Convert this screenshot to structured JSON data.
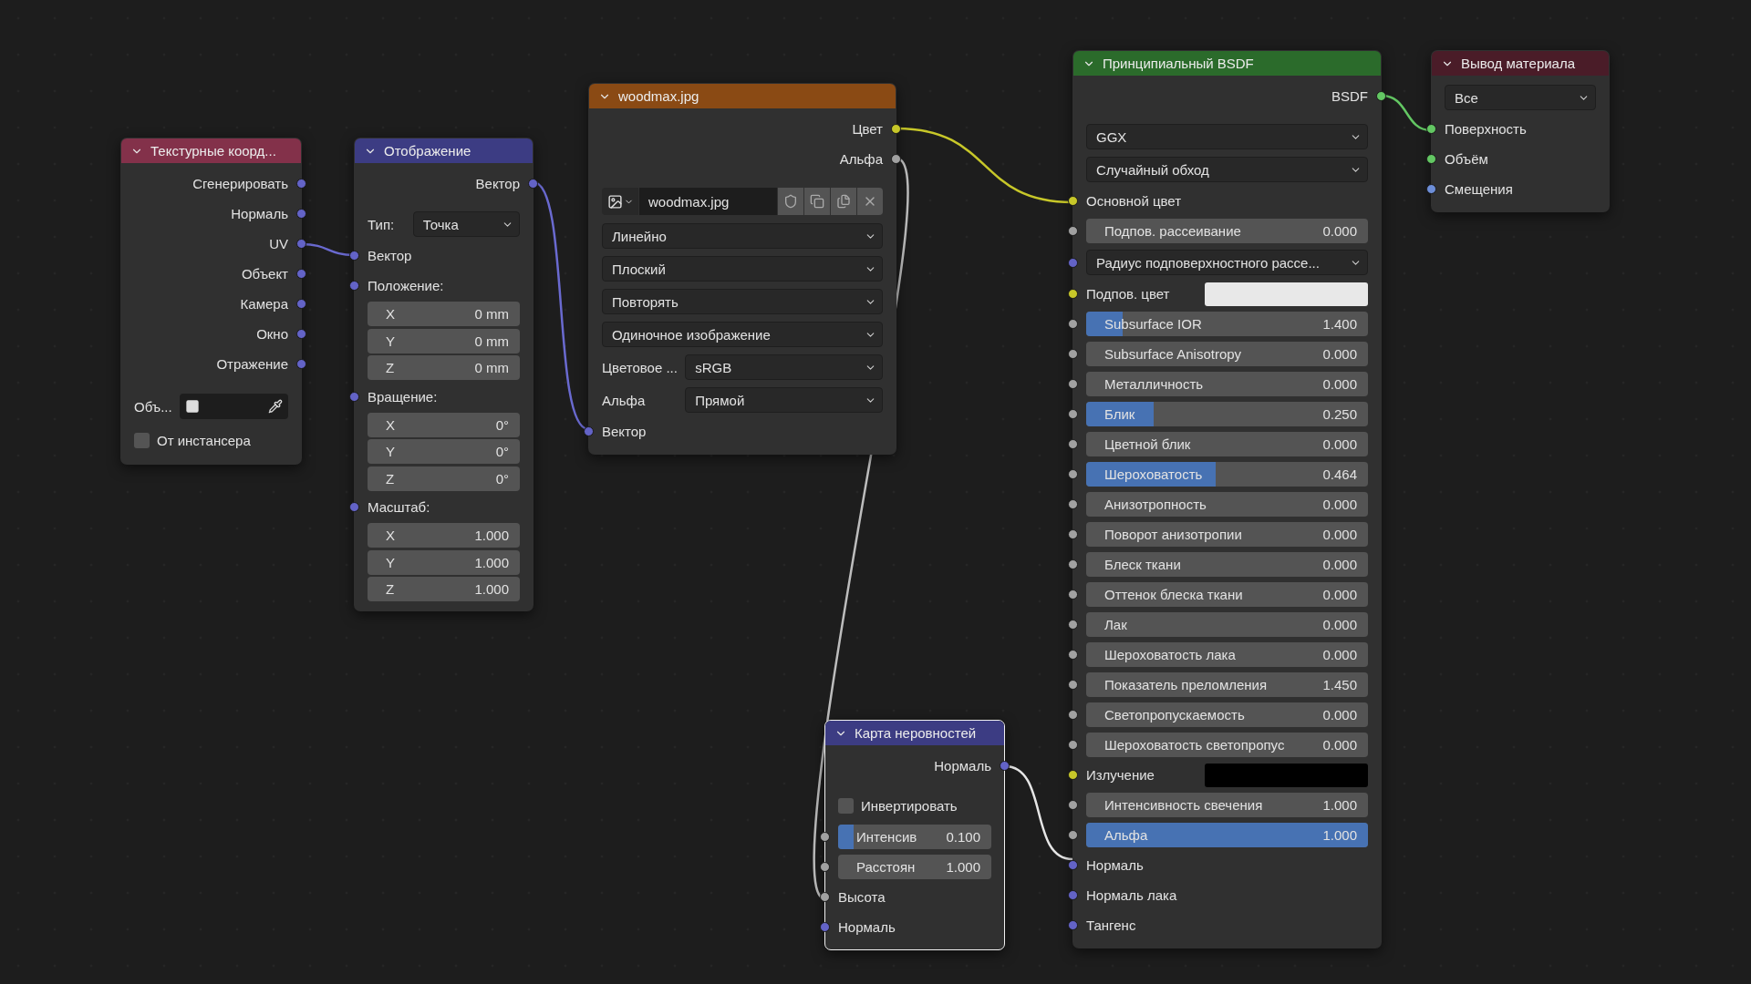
{
  "nodes": [
    {
      "title": "Текстурные коорд...",
      "color": "#83314a",
      "selected": false,
      "rows": [
        {
          "kind": "output",
          "label": "Сгенерировать",
          "socket": {
            "kind": "vector"
          }
        },
        {
          "kind": "output",
          "label": "Нормаль",
          "socket": {
            "kind": "vector"
          }
        },
        {
          "kind": "output",
          "label": "UV",
          "socket": {
            "kind": "vector"
          }
        },
        {
          "kind": "output",
          "label": "Объект",
          "socket": {
            "kind": "vector"
          }
        },
        {
          "kind": "output",
          "label": "Камера",
          "socket": {
            "kind": "vector"
          }
        },
        {
          "kind": "output",
          "label": "Окно",
          "socket": {
            "kind": "vector"
          }
        },
        {
          "kind": "output",
          "label": "Отражение",
          "socket": {
            "kind": "vector"
          }
        },
        {
          "kind": "object_picker",
          "label": "Объ..."
        },
        {
          "kind": "checkbox",
          "label": "От инстансера",
          "checked": false
        }
      ]
    },
    {
      "title": "Отображение",
      "color": "#3c3c83",
      "selected": false,
      "rows": [
        {
          "kind": "output",
          "label": "Вектор",
          "socket": {
            "kind": "vector"
          }
        },
        {
          "kind": "labeled_dropdown",
          "label": "Тип:",
          "value": "Точка"
        },
        {
          "kind": "input",
          "label": "Вектор",
          "socket": {
            "kind": "vector"
          }
        },
        {
          "kind": "input",
          "label": "Положение:",
          "socket": {
            "kind": "vector"
          }
        },
        {
          "kind": "component",
          "axis": "X",
          "value": "0 mm"
        },
        {
          "kind": "component",
          "axis": "Y",
          "value": "0 mm"
        },
        {
          "kind": "component",
          "axis": "Z",
          "value": "0 mm"
        },
        {
          "kind": "input",
          "label": "Вращение:",
          "socket": {
            "kind": "vector"
          }
        },
        {
          "kind": "component",
          "axis": "X",
          "value": "0°"
        },
        {
          "kind": "component",
          "axis": "Y",
          "value": "0°"
        },
        {
          "kind": "component",
          "axis": "Z",
          "value": "0°"
        },
        {
          "kind": "input",
          "label": "Масштаб:",
          "socket": {
            "kind": "vector"
          }
        },
        {
          "kind": "component",
          "axis": "X",
          "value": "1.000"
        },
        {
          "kind": "component",
          "axis": "Y",
          "value": "1.000"
        },
        {
          "kind": "component",
          "axis": "Z",
          "value": "1.000"
        }
      ]
    },
    {
      "title": "woodmax.jpg",
      "color": "#8a4a14",
      "selected": false,
      "rows": [
        {
          "kind": "output",
          "label": "Цвет",
          "socket": {
            "kind": "color"
          }
        },
        {
          "kind": "output",
          "label": "Альфа",
          "socket": {
            "kind": "float"
          }
        },
        {
          "kind": "image_picker",
          "value": "woodmax.jpg"
        },
        {
          "kind": "dropdown",
          "value": "Линейно"
        },
        {
          "kind": "dropdown",
          "value": "Плоский"
        },
        {
          "kind": "dropdown",
          "value": "Повторять"
        },
        {
          "kind": "dropdown",
          "value": "Одиночное изображение"
        },
        {
          "kind": "labeled_dropdown",
          "label": "Цветовое ...",
          "value": "sRGB"
        },
        {
          "kind": "labeled_dropdown",
          "label": "Альфа",
          "value": "Прямой"
        },
        {
          "kind": "input",
          "label": "Вектор",
          "socket": {
            "kind": "vector"
          }
        }
      ]
    },
    {
      "title": "Принципиальный BSDF",
      "color": "#2b6b2b",
      "selected": false,
      "rows": [
        {
          "kind": "output",
          "label": "BSDF",
          "socket": {
            "kind": "shader"
          }
        },
        {
          "kind": "dropdown",
          "value": "GGX"
        },
        {
          "kind": "dropdown",
          "value": "Случайный обход"
        },
        {
          "kind": "input",
          "label": "Основной цвет",
          "socket": {
            "kind": "color"
          }
        },
        {
          "kind": "slider",
          "label": "Подпов. рассеивание",
          "value": "0.000",
          "socket": {
            "kind": "float"
          }
        },
        {
          "kind": "dropdown",
          "value": "Радиус подповерхностного рассе...",
          "socket": {
            "kind": "vector"
          }
        },
        {
          "kind": "color",
          "label": "Подпов. цвет",
          "socket": {
            "kind": "color"
          },
          "color": "#e8e8e8"
        },
        {
          "kind": "slider",
          "label": "Subsurface IOR",
          "value": "1.400",
          "socket": {
            "kind": "float"
          },
          "level": 0.13
        },
        {
          "kind": "slider",
          "label": "Subsurface Anisotropy",
          "value": "0.000",
          "socket": {
            "kind": "float"
          }
        },
        {
          "kind": "slider",
          "label": "Металличность",
          "value": "0.000",
          "socket": {
            "kind": "float"
          }
        },
        {
          "kind": "slider",
          "label": "Блик",
          "value": "0.250",
          "socket": {
            "kind": "float"
          },
          "level": 0.24
        },
        {
          "kind": "slider",
          "label": "Цветной блик",
          "value": "0.000",
          "socket": {
            "kind": "float"
          }
        },
        {
          "kind": "slider",
          "label": "Шероховатость",
          "value": "0.464",
          "socket": {
            "kind": "float"
          },
          "level": 0.46
        },
        {
          "kind": "slider",
          "label": "Анизотропность",
          "value": "0.000",
          "socket": {
            "kind": "float"
          }
        },
        {
          "kind": "slider",
          "label": "Поворот анизотропии",
          "value": "0.000",
          "socket": {
            "kind": "float"
          }
        },
        {
          "kind": "slider",
          "label": "Блеск ткани",
          "value": "0.000",
          "socket": {
            "kind": "float"
          }
        },
        {
          "kind": "slider",
          "label": "Оттенок блеска ткани",
          "value": "0.000",
          "socket": {
            "kind": "float"
          }
        },
        {
          "kind": "slider",
          "label": "Лак",
          "value": "0.000",
          "socket": {
            "kind": "float"
          }
        },
        {
          "kind": "slider",
          "label": "Шероховатость лака",
          "value": "0.000",
          "socket": {
            "kind": "float"
          }
        },
        {
          "kind": "slider",
          "label": "Показатель преломления",
          "value": "1.450",
          "socket": {
            "kind": "float"
          }
        },
        {
          "kind": "slider",
          "label": "Светопропускаемость",
          "value": "0.000",
          "socket": {
            "kind": "float"
          }
        },
        {
          "kind": "slider",
          "label": "Шероховатость светопропус",
          "value": "0.000",
          "socket": {
            "kind": "float"
          }
        },
        {
          "kind": "color",
          "label": "Излучение",
          "socket": {
            "kind": "color"
          },
          "color": "#000000"
        },
        {
          "kind": "slider",
          "label": "Интенсивность свечения",
          "value": "1.000",
          "socket": {
            "kind": "float"
          }
        },
        {
          "kind": "slider",
          "label": "Альфа",
          "value": "1.000",
          "socket": {
            "kind": "float"
          },
          "level": 1
        },
        {
          "kind": "input",
          "label": "Нормаль",
          "socket": {
            "kind": "vector"
          }
        },
        {
          "kind": "input",
          "label": "Нормаль лака",
          "socket": {
            "kind": "vector"
          }
        },
        {
          "kind": "input",
          "label": "Тангенс",
          "socket": {
            "kind": "vector"
          }
        }
      ]
    },
    {
      "title": "Вывод материала",
      "color": "#4a1c28",
      "selected": false,
      "rows": [
        {
          "kind": "dropdown",
          "value": "Все"
        },
        {
          "kind": "input",
          "label": "Поверхность",
          "socket": {
            "kind": "shader"
          }
        },
        {
          "kind": "input",
          "label": "Объём",
          "socket": {
            "kind": "shader"
          }
        },
        {
          "kind": "input",
          "label": "Смещения",
          "socket": {
            "kind": "displacement"
          }
        }
      ]
    },
    {
      "title": "Карта неровностей",
      "color": "#3c3c83",
      "selected": true,
      "rows": [
        {
          "kind": "output",
          "label": "Нормаль",
          "socket": {
            "kind": "vector"
          }
        },
        {
          "kind": "checkbox",
          "label": "Инвертировать",
          "checked": false
        },
        {
          "kind": "slider",
          "label": "Интенсив",
          "value": "0.100",
          "socket": {
            "kind": "float"
          },
          "level": 0.1
        },
        {
          "kind": "slider",
          "label": "Расстоян",
          "value": "1.000",
          "socket": {
            "kind": "float"
          }
        },
        {
          "kind": "input",
          "label": "Высота",
          "socket": {
            "kind": "float"
          }
        },
        {
          "kind": "input",
          "label": "Нормаль",
          "socket": {
            "kind": "vector"
          }
        }
      ]
    }
  ]
}
